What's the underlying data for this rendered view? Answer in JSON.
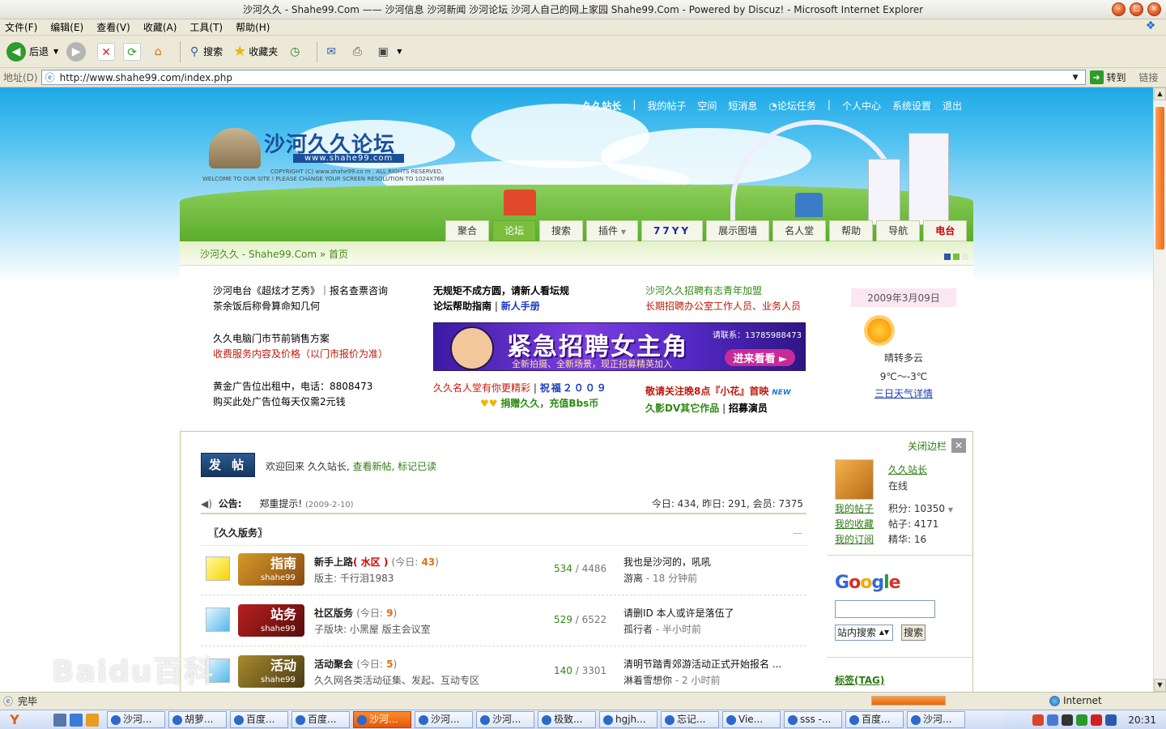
{
  "window": {
    "title": "沙河久久 - Shahe99.Com —— 沙河信息 沙河新闻 沙河论坛 沙河人自己的网上家园 Shahe99.Com - Powered by Discuz! - Microsoft Internet Explorer"
  },
  "menubar": {
    "items": [
      "文件(F)",
      "编辑(E)",
      "查看(V)",
      "收藏(A)",
      "工具(T)",
      "帮助(H)"
    ]
  },
  "toolbar": {
    "back": "后退",
    "search": "搜索",
    "favorites": "收藏夹"
  },
  "address": {
    "label": "地址(D)",
    "url": "http://www.shahe99.com/index.php",
    "go": "转到",
    "links": "链接"
  },
  "header": {
    "topnav": [
      "久久站长",
      "|",
      "我的帖子",
      "空间",
      "短消息",
      "论坛任务",
      "|",
      "个人中心",
      "系统设置",
      "退出"
    ],
    "logo_title": "沙河久久论坛",
    "logo_url": "www.shahe99.com",
    "logo_copyright": "COPYRIGHT (C) www.shahe99.co m . ALL RIGHTS RESERVED.",
    "logo_welcome": "WELCOME TO OUR SITE ! PLEASE CHANGE YOUR SCREEN RESOLUTION TO 1024X768",
    "tabs": [
      "聚合",
      "论坛",
      "搜索",
      "插件",
      "77YY",
      "展示图墙",
      "名人堂",
      "帮助",
      "导航",
      "电台"
    ],
    "active_tab": "论坛"
  },
  "breadcrumb": {
    "site": "沙河久久 - Shahe99.Com",
    "sep": "»",
    "page": "首页"
  },
  "ads": {
    "col1": [
      "沙河电台《超炫才艺秀》｜报名查票咨询",
      "茶余饭后称骨算命知几何",
      "久久电脑门市节前销售方案",
      "收费服务内容及价格（以门市报价为准）",
      "黄金广告位出租中，电话：8808473",
      "购买此处广告位每天仅需2元钱"
    ],
    "col2_top": [
      "无规矩不成方圆，请新人看坛规",
      "论坛帮助指南",
      "新人手册"
    ],
    "col2_bottom": [
      "久久名人堂有你更精彩",
      "祝福２００９",
      "捐赠久久，充值Bbs币"
    ],
    "col3_top": [
      "沙河久久招聘有志青年加盟",
      "长期招聘办公室工作人员、业务人员"
    ],
    "col3_bottom": [
      "敬请关注晚8点『小花』首映",
      "久影DV其它作品",
      "招募演员"
    ],
    "banner": {
      "title": "紧急招聘女主角",
      "sub": "全新拍摄、全新场景，现正招募精英加入",
      "phone": "请联系：13785988473",
      "btn": "进来看看"
    }
  },
  "weather": {
    "date": "2009年3月09日",
    "desc": "晴转多云",
    "temp": "9℃～-3℃",
    "link": "三日天气详情"
  },
  "main": {
    "post_btn": "发 帖",
    "welcome": "欢迎回来 久久站长,",
    "new_posts": "查看新帖,",
    "mark_read": "标记已读",
    "close_sidebar": "关闭边栏",
    "notice_label": "公告:",
    "notice_title": "郑重提示!",
    "notice_date": "(2009-2-10)",
    "stats": "今日: 434, 昨日: 291, 会员: 7375",
    "section": "〖久久版务〗",
    "forums": [
      {
        "icon_text": "指南",
        "icon_sub": "shahe99",
        "name": "新手上路",
        "tag": "( 水区 )",
        "today_label": "(今日:",
        "today": "43",
        "today_end": ")",
        "desc": "版主: 千行泪1983",
        "threads": "534",
        "posts": "4486",
        "last_title": "我也是沙河的，吼吼",
        "last_user": "游离",
        "last_time": "- 18 分钟前"
      },
      {
        "icon_text": "站务",
        "icon_sub": "shahe99",
        "name": "社区版务",
        "tag": "",
        "today_label": "(今日:",
        "today": "9",
        "today_end": ")",
        "desc": "子版块: 小黑屋   版主会议室",
        "threads": "529",
        "posts": "6522",
        "last_title": "请删ID 本人或许是落伍了",
        "last_user": "孤行者",
        "last_time": "- 半小时前"
      },
      {
        "icon_text": "活动",
        "icon_sub": "shahe99",
        "name": "活动聚会",
        "tag": "",
        "today_label": "(今日:",
        "today": "5",
        "today_end": ")",
        "desc": "久久网各类活动征集、发起、互动专区",
        "threads": "140",
        "posts": "3301",
        "last_title": "清明节踏青郊游活动正式开始报名 ...",
        "last_user": "淋着雪想你",
        "last_time": "- 2 小时前"
      }
    ]
  },
  "sidebar": {
    "username": "久久站长",
    "status": "在线",
    "links": [
      "我的帖子",
      "我的收藏",
      "我的订阅"
    ],
    "stats": [
      "积分: 10350",
      "帖子: 4171",
      "精华: 16"
    ],
    "google": "Google",
    "search_option": "站内搜索",
    "search_btn": "搜索",
    "tag_title": "标签(TAG)"
  },
  "watermark": "Baidu百科",
  "status": {
    "text": "完毕",
    "zone": "Internet"
  },
  "taskbar": {
    "tasks": [
      "沙河...",
      "胡萝...",
      "百度...",
      "百度...",
      "沙河...",
      "沙河...",
      "沙河...",
      "极致...",
      "hgjh...",
      "忘记...",
      "Vie...",
      "sss -...",
      "百度...",
      "沙河..."
    ],
    "active_index": 4,
    "clock": "20:31"
  }
}
